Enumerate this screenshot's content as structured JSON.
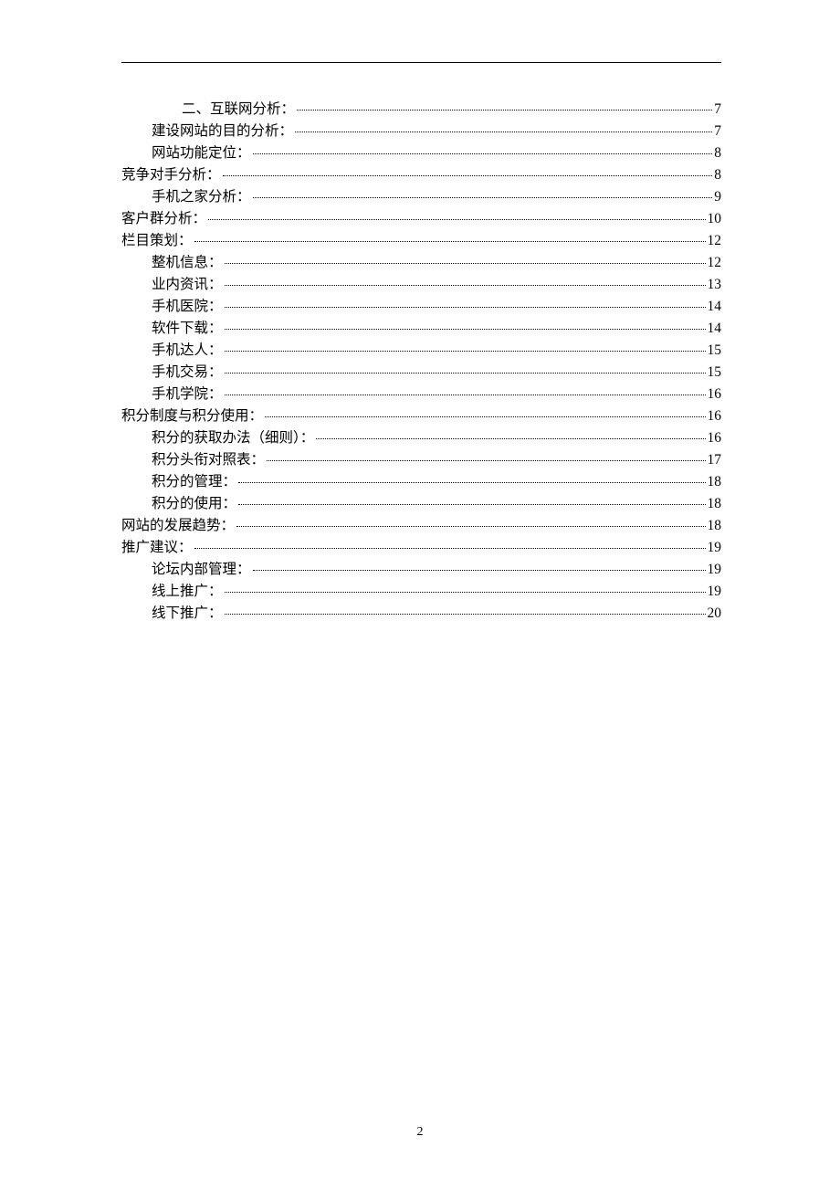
{
  "page_number": "2",
  "toc": [
    {
      "level": 2,
      "label": "二、互联网分析：",
      "page": "7"
    },
    {
      "level": 1,
      "label": "建设网站的目的分析：",
      "page": "7"
    },
    {
      "level": 1,
      "label": "网站功能定位：",
      "page": "8"
    },
    {
      "level": 0,
      "label": "竞争对手分析：",
      "page": "8"
    },
    {
      "level": 1,
      "label": "手机之家分析：",
      "page": "9"
    },
    {
      "level": 0,
      "label": "客户群分析：",
      "page": "10"
    },
    {
      "level": 0,
      "label": "栏目策划：",
      "page": "12"
    },
    {
      "level": 1,
      "label": "整机信息：",
      "page": "12"
    },
    {
      "level": 1,
      "label": "业内资讯：",
      "page": "13"
    },
    {
      "level": 1,
      "label": "手机医院：",
      "page": "14"
    },
    {
      "level": 1,
      "label": "软件下载：",
      "page": "14"
    },
    {
      "level": 1,
      "label": "手机达人：",
      "page": "15"
    },
    {
      "level": 1,
      "label": "手机交易：",
      "page": "15"
    },
    {
      "level": 1,
      "label": "手机学院：",
      "page": "16"
    },
    {
      "level": 0,
      "label": "积分制度与积分使用：",
      "page": "16"
    },
    {
      "level": 1,
      "label": "积分的获取办法（细则）：",
      "page": "16"
    },
    {
      "level": 1,
      "label": "积分头衔对照表：",
      "page": "17"
    },
    {
      "level": 1,
      "label": "积分的管理：",
      "page": "18"
    },
    {
      "level": 1,
      "label": "积分的使用：",
      "page": "18"
    },
    {
      "level": 0,
      "label": "网站的发展趋势：",
      "page": "18"
    },
    {
      "level": 0,
      "label": "推广建议：",
      "page": "19"
    },
    {
      "level": 1,
      "label": "论坛内部管理：",
      "page": "19"
    },
    {
      "level": 1,
      "label": "线上推广：",
      "page": "19"
    },
    {
      "level": 1,
      "label": "线下推广：",
      "page": "20"
    }
  ]
}
